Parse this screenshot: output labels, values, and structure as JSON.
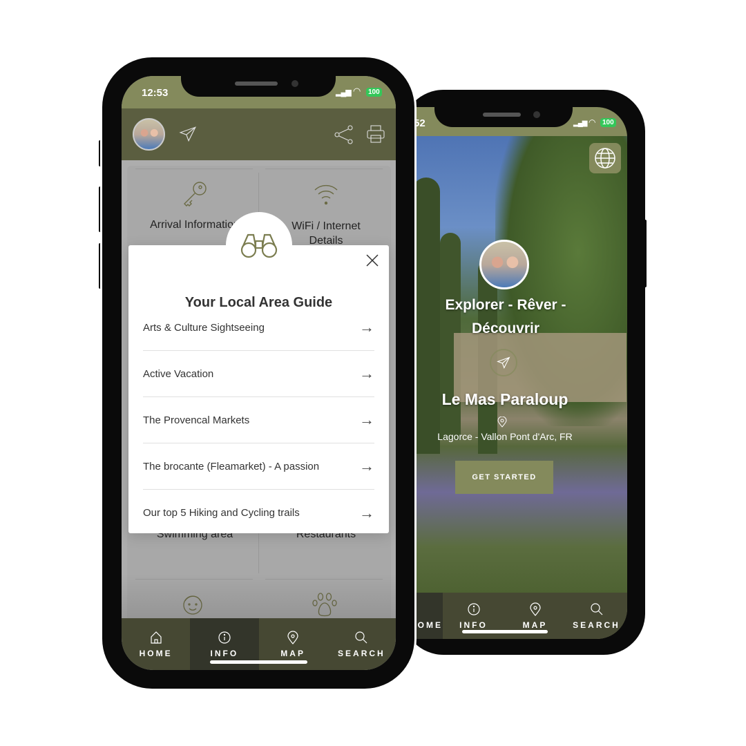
{
  "back_phone": {
    "status": {
      "time": "52",
      "battery": "100"
    },
    "hero": {
      "tagline": "Explorer - Rêver - Découvrir",
      "property_name": "Le Mas Paraloup",
      "location": "Lagorce - Vallon Pont d'Arc, FR",
      "cta_label": "GET STARTED"
    },
    "tabs": [
      {
        "label": "HOME",
        "icon": "home-icon"
      },
      {
        "label": "INFO",
        "icon": "info-icon"
      },
      {
        "label": "MAP",
        "icon": "map-pin-icon"
      },
      {
        "label": "SEARCH",
        "icon": "search-icon"
      }
    ]
  },
  "front_phone": {
    "status": {
      "time": "12:53",
      "battery": "100"
    },
    "grid": [
      "Arrival Information",
      "WiFi / Internet Details",
      "Swimming area",
      "Restaurants"
    ],
    "modal": {
      "title": "Your Local Area Guide",
      "items": [
        "Arts & Culture Sightseeing",
        "Active Vacation",
        "The Provencal Markets",
        "The brocante (Fleamarket) - A passion",
        "Our top 5 Hiking and Cycling trails"
      ]
    },
    "tabs": [
      {
        "label": "HOME",
        "icon": "home-icon"
      },
      {
        "label": "INFO",
        "icon": "info-icon",
        "active": true
      },
      {
        "label": "MAP",
        "icon": "map-pin-icon"
      },
      {
        "label": "SEARCH",
        "icon": "search-icon"
      }
    ]
  },
  "colors": {
    "brand_olive": "#848a5c",
    "header_dark": "#5b5e40",
    "tabbar": "#464833",
    "battery_green": "#34c759"
  }
}
